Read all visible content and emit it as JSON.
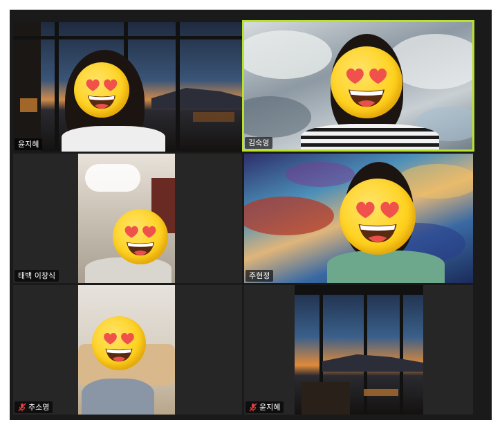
{
  "meeting": {
    "participants": [
      {
        "name": "윤지혜",
        "muted": false,
        "active_speaker": false
      },
      {
        "name": "김숙영",
        "muted": false,
        "active_speaker": true
      },
      {
        "name": "태백 이창식",
        "muted": false,
        "active_speaker": false
      },
      {
        "name": "주현정",
        "muted": false,
        "active_speaker": false
      },
      {
        "name": "추소영",
        "muted": true,
        "active_speaker": false
      },
      {
        "name": "윤지혜",
        "muted": true,
        "active_speaker": false
      }
    ]
  },
  "colors": {
    "active_speaker_border": "#b9e22b",
    "mute_icon": "#e03b3b",
    "tile_background": "#262626"
  },
  "icons": {
    "face_cover": "heart-eyes-emoji-icon",
    "muted": "microphone-muted-icon"
  }
}
